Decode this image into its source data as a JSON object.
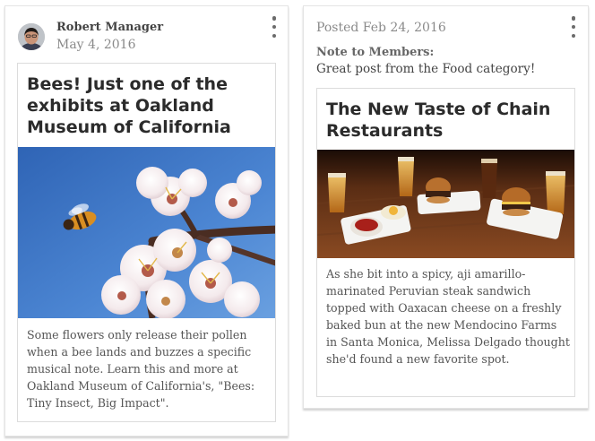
{
  "posts": [
    {
      "author": "Robert Manager",
      "date": "May 4, 2016",
      "title": "Bees! Just one of the exhibits at Oakland Museum of California",
      "description": "Some flowers only release their pollen when a bee lands and buzzes a specific musical note. Learn this and more at Oakland Museum of California's, \"Bees: Tiny Insect, Big Impact\".",
      "image": "bee-on-blossoms-photo",
      "menu_icon": "vertical-ellipsis-icon"
    },
    {
      "posted": "Posted Feb 24, 2016",
      "note_label": "Note to Members:",
      "note_text": "Great post from the Food category!",
      "title": "The New Taste of Chain Restaurants",
      "description": "As she bit into a spicy, aji amarillo-marinated Peruvian steak sandwich topped with Oaxacan cheese on a freshly baked bun at the new Mendocino Farms in Santa Monica, Melissa Delgado thought she'd found a new favorite spot.",
      "image": "sliders-and-beer-photo",
      "menu_icon": "vertical-ellipsis-icon"
    }
  ],
  "colors": {
    "title": "#2b2b2b",
    "body_text": "#555555",
    "muted": "#8a8a8a",
    "card_border": "#e4e4e4"
  }
}
